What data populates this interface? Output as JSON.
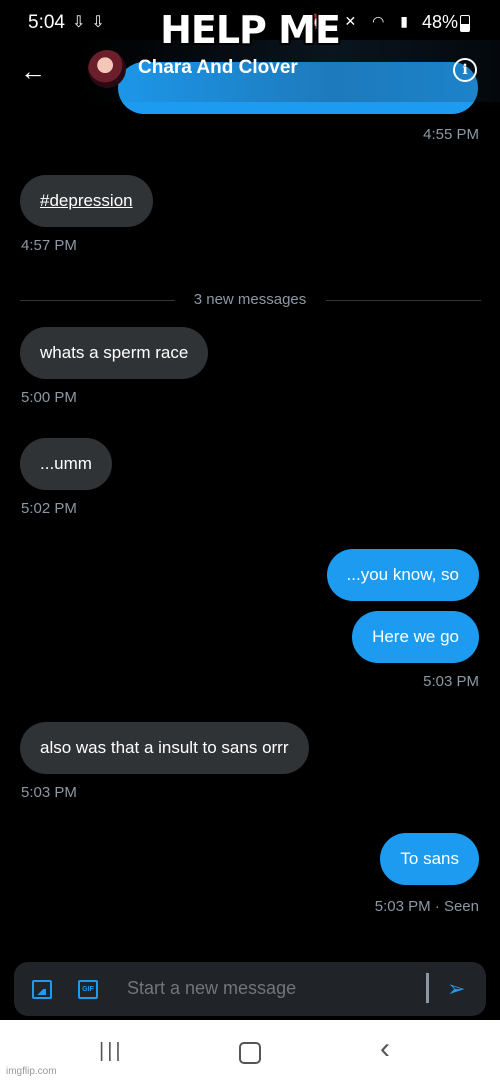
{
  "status_bar": {
    "time": "5:04",
    "battery": "48%"
  },
  "meme_caption": "HELP ME",
  "header": {
    "contact_name": "Chara And Clover"
  },
  "conversation": {
    "prior_timestamp": "4:55 PM",
    "hashtag_message": "#depression",
    "hashtag_time": "4:57 PM",
    "new_messages_divider": "3 new messages",
    "msg1": "whats a sperm race",
    "msg1_time": "5:00 PM",
    "msg2": "...umm",
    "msg2_time": "5:02 PM",
    "sent1": "...you know, so",
    "sent2": "Here we go",
    "sent_time": "5:03 PM",
    "msg3": "also was that a insult to sans orrr",
    "msg3_time": "5:03 PM",
    "sent3": "To sans",
    "sent3_time": "5:03 PM · Seen"
  },
  "composer": {
    "placeholder": "Start a new message",
    "gif_label": "GIF"
  },
  "watermark": "imgflip.com",
  "colors": {
    "accent": "#1d9bf0",
    "incoming_bubble": "#2f3336",
    "background": "#000000"
  }
}
